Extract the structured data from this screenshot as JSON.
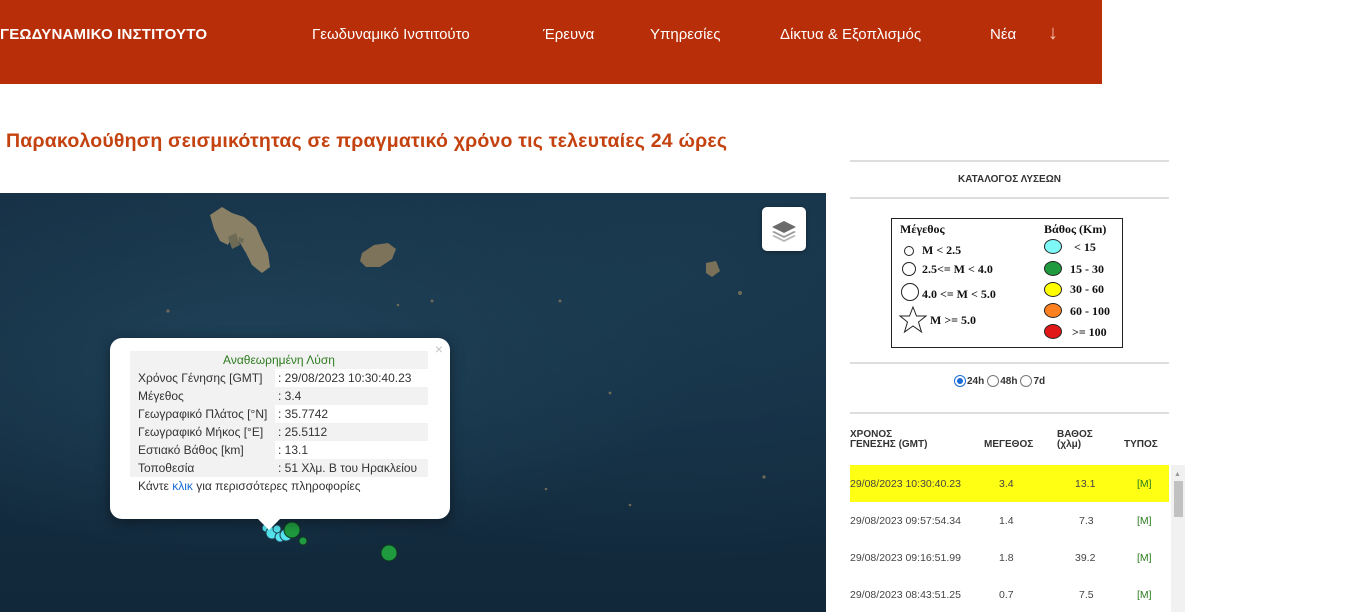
{
  "nav": {
    "brand": "ΓΕΩΔΥΝΑΜΙΚΟ ΙΝΣΤΙΤΟΥΤΟ",
    "items": [
      "Γεωδυναμικό Ινστιτούτο",
      "Έρευνα",
      "Υπηρεσίες",
      "Δίκτυα & Εξοπλισμός",
      "Νέα"
    ],
    "more_icon": "arrow-down-icon"
  },
  "page_title": "Παρακολούθηση σεισμικότητας σε πραγματικό χρόνο τις τελευταίες 24 ώρες",
  "map": {
    "layers_icon": "layers-icon",
    "popup": {
      "header": "Αναθεωρημένη Λύση",
      "rows": [
        {
          "key": "Χρόνος Γένησης [GMT]",
          "value": ": 29/08/2023 10:30:40.23"
        },
        {
          "key": "Μέγεθος",
          "value": ": 3.4"
        },
        {
          "key": "Γεωγραφικό Πλάτος [°N]",
          "value": ": 35.7742"
        },
        {
          "key": "Γεωγραφικό Μήκος [°E]",
          "value": ": 25.5112"
        },
        {
          "key": "Εστιακό Βάθος [km]",
          "value": ": 13.1"
        },
        {
          "key": "Τοποθεσία",
          "value": ": 51 Χλμ. Β του Ηρακλείου"
        }
      ],
      "more_prefix": "Κάντε ",
      "more_link": "κλικ",
      "more_suffix": " για περισσότερες πληροφορίες",
      "close": "×"
    },
    "colors": {
      "sea": "#173247",
      "cyan": "#55e4ee",
      "green": "#1f9a3f"
    }
  },
  "sidebar": {
    "catalog_title": "ΚΑΤΑΛΟΓΟΣ ΛΥΣΕΩΝ",
    "legend": {
      "magnitude_title": "Μέγεθος",
      "magnitude_items": [
        "M < 2.5",
        "2.5<= M < 4.0",
        "4.0 <= M < 5.0",
        "M >= 5.0"
      ],
      "depth_title": "Βάθος (Km)",
      "depth_items": [
        {
          "label": "< 15",
          "color": "#7ff7f7"
        },
        {
          "label": "15 - 30",
          "color": "#1f9a3f"
        },
        {
          "label": "30 - 60",
          "color": "#ffff00"
        },
        {
          "label": "60 - 100",
          "color": "#ff8020"
        },
        {
          "label": ">= 100",
          "color": "#e01818"
        }
      ]
    },
    "period": {
      "options": [
        "24h",
        "48h",
        "7d"
      ],
      "selected": "24h"
    },
    "table": {
      "headers": {
        "time_line1": "ΧΡΟΝΟΣ",
        "time_line2": "ΓΕΝΕΣΗΣ (GMT)",
        "magnitude": "ΜΕΓΕΘΟΣ",
        "depth_line1": "ΒΑΘΟΣ",
        "depth_line2": "(χλμ)",
        "type": "ΤΥΠΟΣ"
      },
      "rows": [
        {
          "time": "29/08/2023 10:30:40.23",
          "mag": "3.4",
          "depth": "13.1",
          "type": "[M]",
          "selected": true
        },
        {
          "time": "29/08/2023 09:57:54.34",
          "mag": "1.4",
          "depth": "7.3",
          "type": "[M]"
        },
        {
          "time": "29/08/2023 09:16:51.99",
          "mag": "1.8",
          "depth": "39.2",
          "type": "[M]"
        },
        {
          "time": "29/08/2023 08:43:51.25",
          "mag": "0.7",
          "depth": "7.5",
          "type": "[M]"
        }
      ]
    }
  }
}
